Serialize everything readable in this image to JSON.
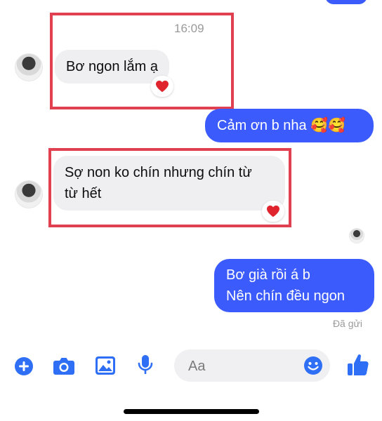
{
  "conversation": {
    "timestamp": "16:09",
    "messages": [
      {
        "direction": "incoming",
        "text": "Bơ ngon lắm ạ",
        "reaction": "red-heart"
      },
      {
        "direction": "outgoing",
        "text": "Cảm ơn b nha 🥰🥰"
      },
      {
        "direction": "incoming",
        "text_line1": "Sợ non ko chín nhưng chín từ",
        "text_line2": "từ hết",
        "reaction": "red-heart"
      },
      {
        "direction": "outgoing",
        "text_line1": "Bơ già rồi á b",
        "text_line2": "Nên chín đều ngon"
      }
    ],
    "status": "Đã gửi"
  },
  "composer": {
    "placeholder": "Aa",
    "icons": [
      "plus-icon",
      "camera-icon",
      "image-icon",
      "microphone-icon",
      "emoji-icon",
      "thumbs-up-icon"
    ]
  },
  "colors": {
    "outgoing_bubble": "#3b5bfd",
    "incoming_bubble": "#efeff1",
    "highlight_box": "#e04050",
    "accent": "#2f6ff5"
  }
}
